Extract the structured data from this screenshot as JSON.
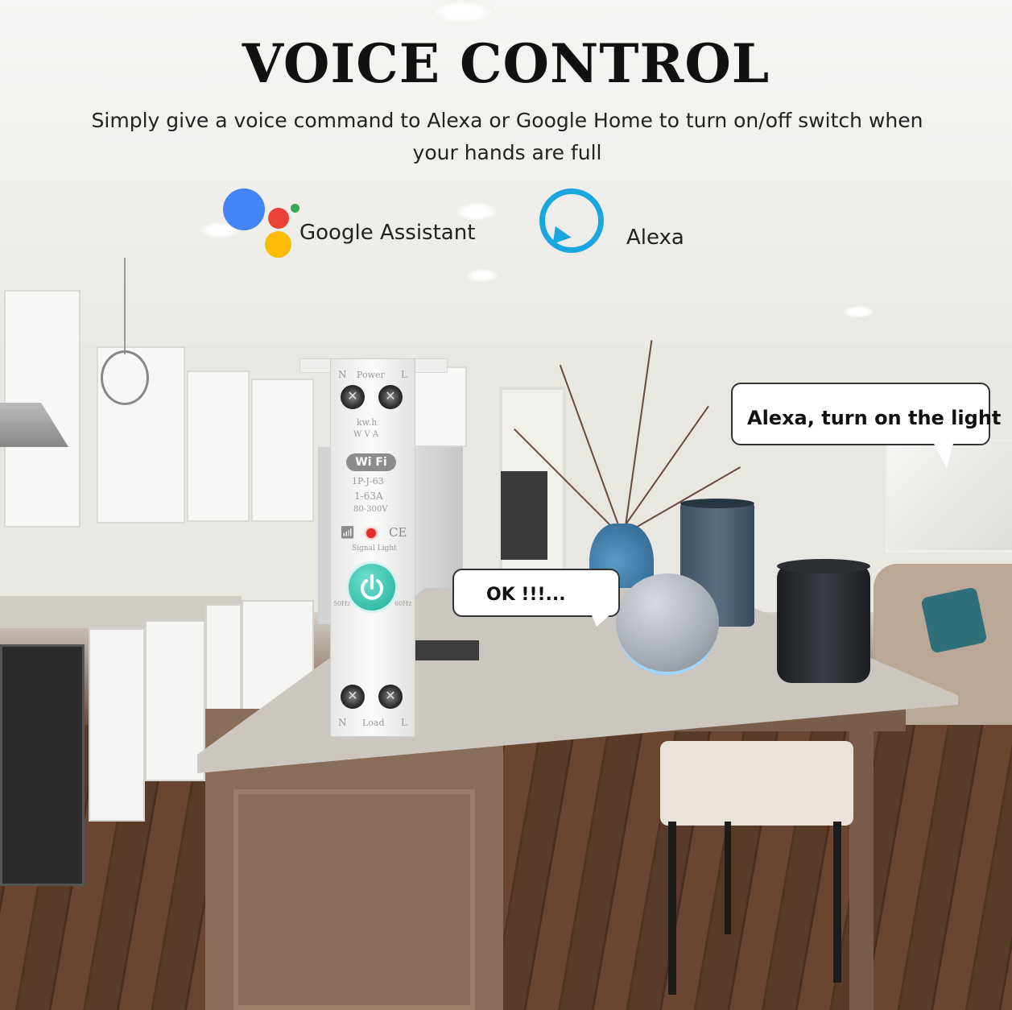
{
  "heading": {
    "title": "VOICE CONTROL",
    "subtitle": "Simply give a voice command to Alexa or Google Home to turn on/off switch when your hands are full"
  },
  "assistants": [
    {
      "label": "Google Assistant",
      "icon": "google-assistant-icon",
      "colors": [
        "#4285F4",
        "#EA4335",
        "#FBBC05",
        "#34A853"
      ]
    },
    {
      "label": "Alexa",
      "icon": "alexa-icon",
      "colors": [
        "#1AA6DE"
      ]
    }
  ],
  "bubbles": {
    "alexa_command": "Alexa, turn on the light",
    "reply": "OK !!!..."
  },
  "device": {
    "top_label_n": "N",
    "top_label_power": "Power",
    "top_label_l": "L",
    "meter_label": "kw.h",
    "meter_units": "W V A",
    "wifi_badge": "Wi Fi",
    "model": "1P-J-63",
    "rating": "1-63A",
    "voltage": "80-300V",
    "ce_mark": "CE",
    "signal_label": "Signal Light",
    "freq_left": "50Hz",
    "freq_right": "60Hz",
    "bottom_label_n": "N",
    "bottom_label_load": "Load",
    "bottom_label_l": "L"
  },
  "accent": {
    "alexa_blue": "#1AA6DE",
    "power_button": "#1FAE9A",
    "led": "#E52B2B"
  }
}
